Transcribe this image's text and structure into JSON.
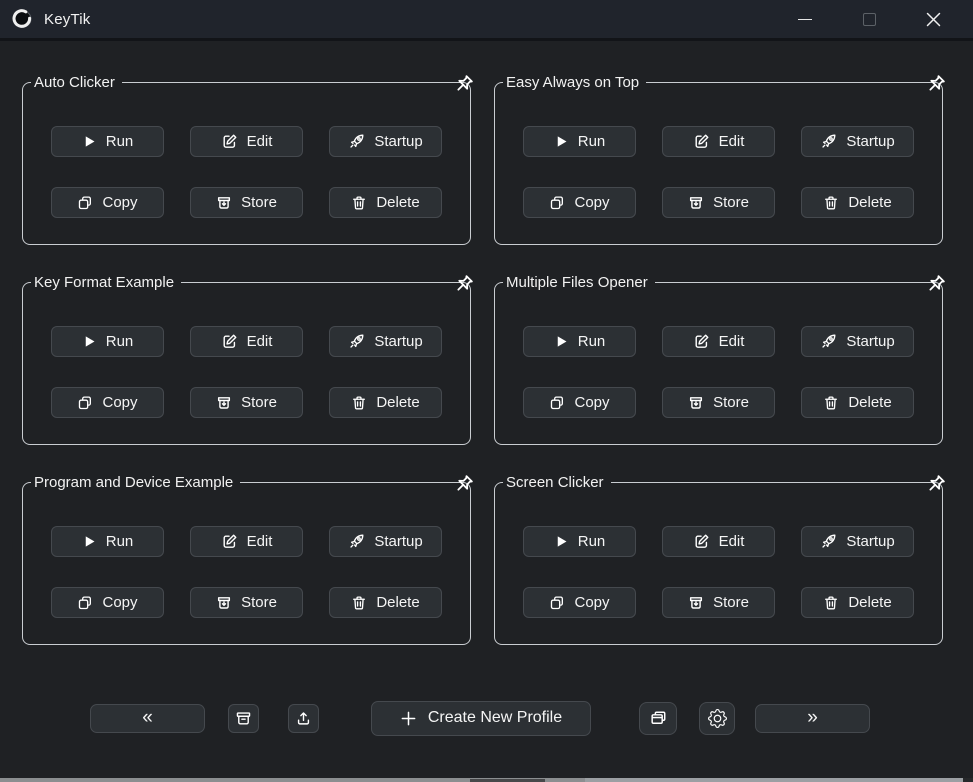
{
  "window": {
    "app_title": "KeyTik",
    "controls": [
      {
        "name": "minimize",
        "icon": "minimize-icon"
      },
      {
        "name": "maximize",
        "icon": "maximize-icon"
      },
      {
        "name": "close",
        "icon": "close-icon"
      }
    ],
    "logo_icon": "keytik-logo-icon"
  },
  "profiles": [
    {
      "title": "Auto Clicker"
    },
    {
      "title": "Easy Always on Top"
    },
    {
      "title": "Key Format Example"
    },
    {
      "title": "Multiple Files Opener"
    },
    {
      "title": "Program and Device Example"
    },
    {
      "title": "Screen Clicker"
    }
  ],
  "card_buttons": [
    {
      "label": "Run",
      "icon": "play-icon"
    },
    {
      "label": "Edit",
      "icon": "edit-icon"
    },
    {
      "label": "Startup",
      "icon": "rocket-icon"
    },
    {
      "label": "Copy",
      "icon": "copy-icon"
    },
    {
      "label": "Store",
      "icon": "archive-in-icon"
    },
    {
      "label": "Delete",
      "icon": "trash-icon"
    }
  ],
  "card_pin_icon": "pin-icon",
  "toolbar": {
    "prev_label": "«",
    "next_label": "»",
    "archive_icon": "archive-box-icon",
    "import_icon": "upload-icon",
    "create": {
      "label": "Create New Profile",
      "icon": "plus-icon"
    },
    "windows_icon": "multi-window-icon",
    "settings_icon": "gear-icon"
  },
  "colors": {
    "window_bg": "#1f2124",
    "titlebar_bg": "#20242c",
    "card_border": "#c9cdd1",
    "button_bg": "#2c3034",
    "button_border": "#45494e",
    "text": "#f5f5f5",
    "taskbar_strip": "#8b8e90"
  }
}
